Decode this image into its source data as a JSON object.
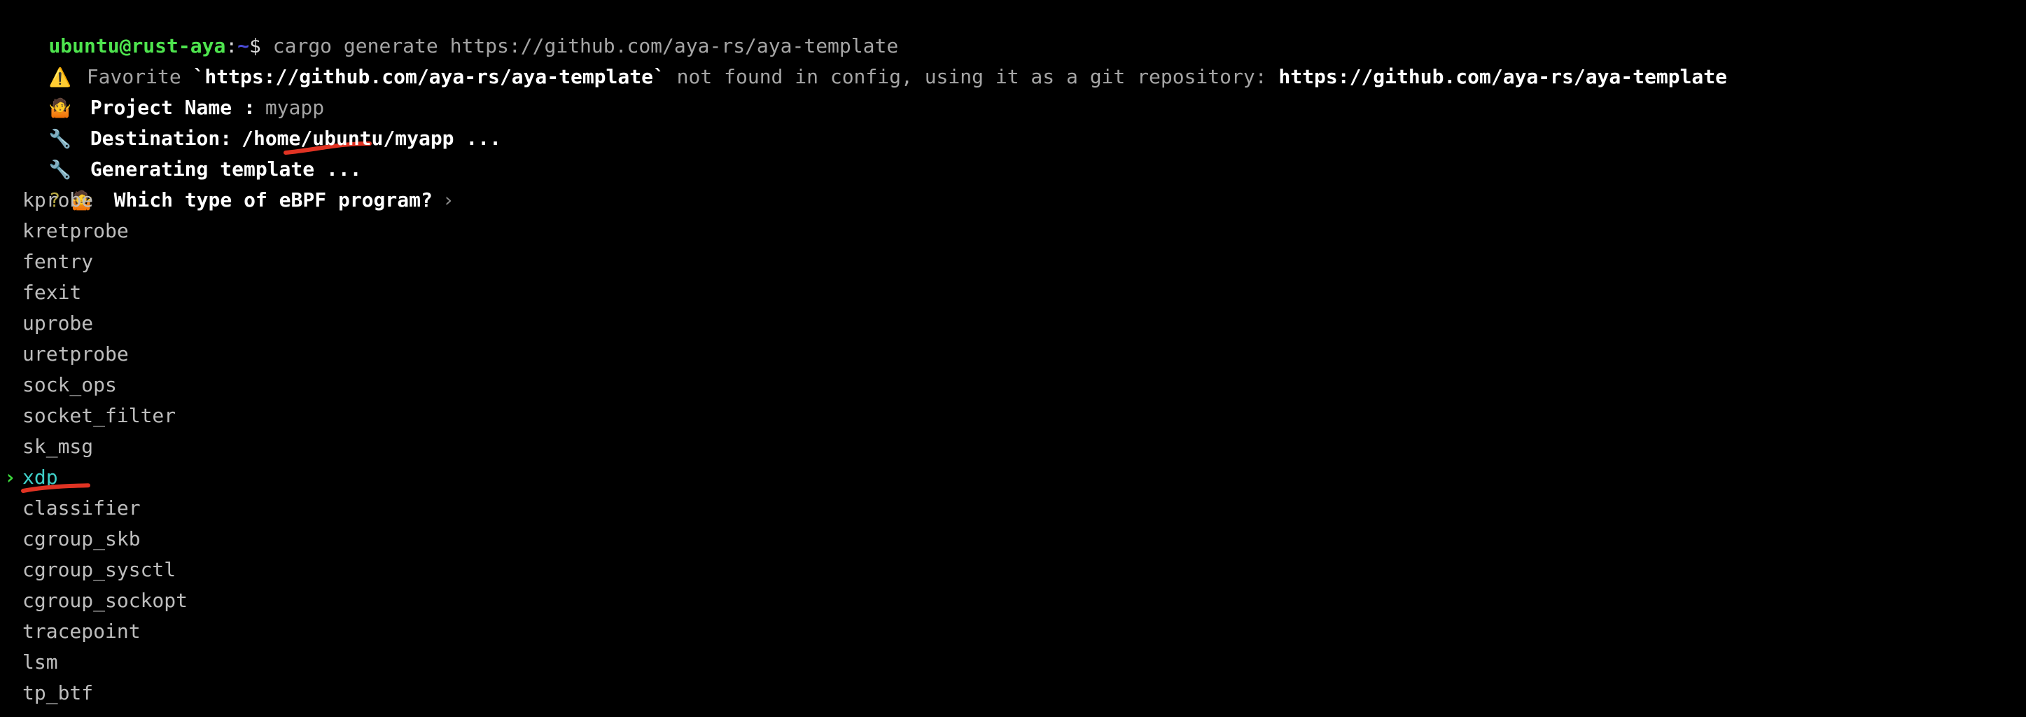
{
  "terminal": {
    "background": "#000000",
    "foreground": "#d8d8d8",
    "prompt": {
      "user_host": "ubuntu@rust-aya",
      "colon": ":",
      "path": "~",
      "sigil": "$",
      "command": " cargo generate https://github.com/aya-rs/aya-template"
    },
    "lines": {
      "warning": {
        "icon": "warning-emoji",
        "icon_glyph": "⚠️",
        "text_a": "Favorite ",
        "url_quoted": "`https://github.com/aya-rs/aya-template`",
        "text_b": " not found in config, using it as a git repository: ",
        "url_plain": "https://github.com/aya-rs/aya-template"
      },
      "project_name": {
        "icon": "shrug-emoji",
        "icon_glyph": "🤷",
        "label": "Project Name :",
        "value": "myapp"
      },
      "destination": {
        "icon": "wrench-emoji",
        "icon_glyph": "🔧",
        "label": "Destination:",
        "value": "/home/ubuntu/myapp ..."
      },
      "generating": {
        "icon": "wrench-emoji",
        "icon_glyph": "🔧",
        "label": "Generating template ..."
      },
      "question": {
        "marker": "?",
        "icon": "shrug-emoji",
        "icon_glyph": "🤷",
        "text": "Which type of eBPF program?",
        "chevron": "›"
      }
    },
    "select_list": {
      "selected_index": 9,
      "selected_chevron": "›",
      "options": [
        {
          "label": "kprobe"
        },
        {
          "label": "kretprobe"
        },
        {
          "label": "fentry"
        },
        {
          "label": "fexit"
        },
        {
          "label": "uprobe"
        },
        {
          "label": "uretprobe"
        },
        {
          "label": "sock_ops"
        },
        {
          "label": "socket_filter"
        },
        {
          "label": "sk_msg"
        },
        {
          "label": "xdp"
        },
        {
          "label": "classifier"
        },
        {
          "label": "cgroup_skb"
        },
        {
          "label": "cgroup_sysctl"
        },
        {
          "label": "cgroup_sockopt"
        },
        {
          "label": "tracepoint"
        },
        {
          "label": "lsm"
        },
        {
          "label": "tp_btf"
        }
      ]
    },
    "annotations": [
      {
        "name": "underline-myapp",
        "color": "#e03323",
        "target": "myapp"
      },
      {
        "name": "underline-xdp",
        "color": "#e03323",
        "target": "xdp"
      }
    ],
    "colors": {
      "prompt_user": "#4ee44e",
      "prompt_path": "#4b4bd8",
      "selected_item": "#3fd0c9",
      "selected_chevron": "#3ddc3d",
      "question_marker": "#b5a642",
      "annotation_red": "#e03323"
    }
  }
}
